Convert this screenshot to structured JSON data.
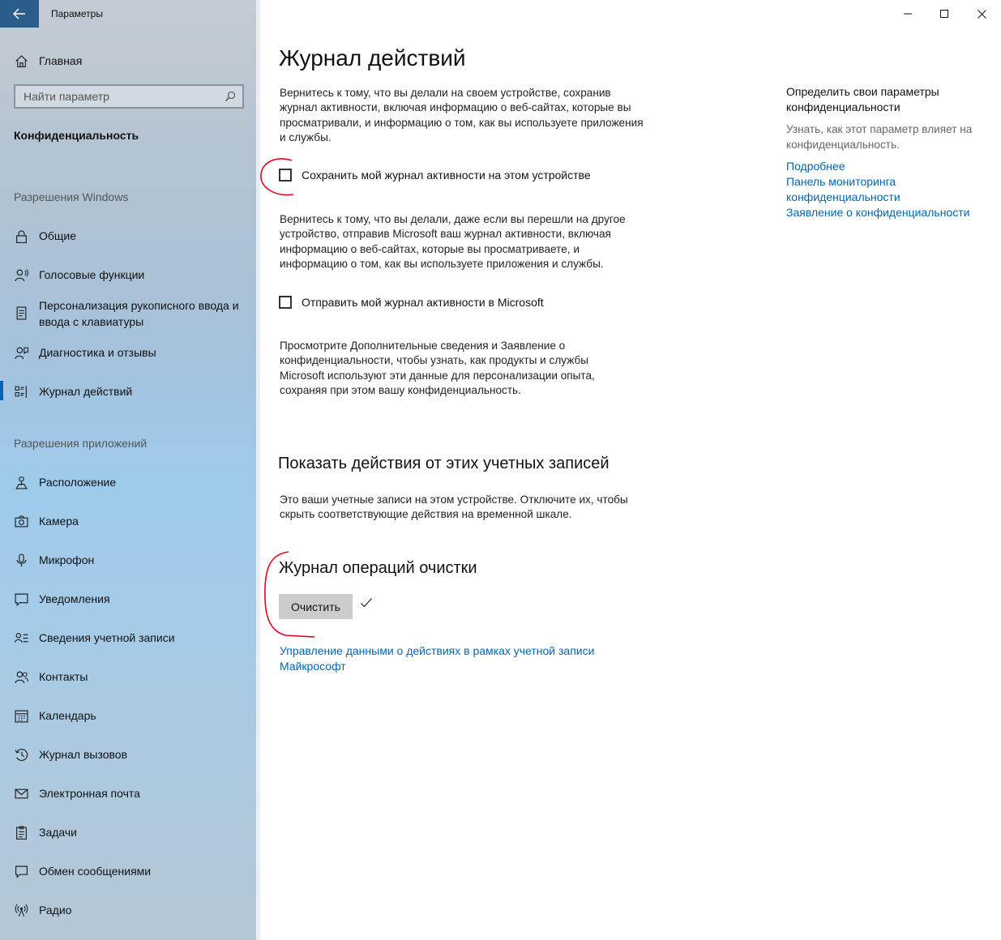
{
  "window": {
    "app_title": "Параметры",
    "back_icon": "back-arrow-icon",
    "controls": [
      "minimize-icon",
      "maximize-icon",
      "close-icon"
    ]
  },
  "sidebar": {
    "home_label": "Главная",
    "search_placeholder": "Найти параметр",
    "category": "Конфиденциальность",
    "windows_section": "Разрешения Windows",
    "windows_items": [
      {
        "label": "Общие",
        "icon": "lock-icon"
      },
      {
        "label": "Голосовые функции",
        "icon": "speech-icon"
      },
      {
        "label": "Персонализация рукописного ввода и ввода с клавиатуры",
        "icon": "handwriting-icon"
      },
      {
        "label": "Диагностика и отзывы",
        "icon": "feedback-icon"
      },
      {
        "label": "Журнал действий",
        "icon": "activity-history-icon",
        "active": true
      }
    ],
    "apps_section": "Разрешения приложений",
    "apps_items": [
      {
        "label": "Расположение",
        "icon": "location-icon"
      },
      {
        "label": "Камера",
        "icon": "camera-icon"
      },
      {
        "label": "Микрофон",
        "icon": "microphone-icon"
      },
      {
        "label": "Уведомления",
        "icon": "notifications-icon"
      },
      {
        "label": "Сведения учетной записи",
        "icon": "account-info-icon"
      },
      {
        "label": "Контакты",
        "icon": "contacts-icon"
      },
      {
        "label": "Календарь",
        "icon": "calendar-icon"
      },
      {
        "label": "Журнал вызовов",
        "icon": "call-history-icon"
      },
      {
        "label": "Электронная почта",
        "icon": "email-icon"
      },
      {
        "label": "Задачи",
        "icon": "tasks-icon"
      },
      {
        "label": "Обмен сообщениями",
        "icon": "messaging-icon"
      },
      {
        "label": "Радио",
        "icon": "radio-icon"
      }
    ]
  },
  "main": {
    "title": "Журнал действий",
    "intro": "Вернитесь к тому, что вы делали на своем устройстве, сохранив журнал активности, включая информацию о веб-сайтах, которые вы просматривали, и информацию о том, как вы используете приложения и службы.",
    "store_checkbox": {
      "label": "Сохранить мой журнал активности на этом устройстве",
      "checked": false
    },
    "send_intro": "Вернитесь к тому, что вы делали, даже если вы перешли на другое устройство, отправив Microsoft ваш журнал активности, включая информацию о веб-сайтах, которые вы просматриваете, и информацию о том, как вы используете приложения и службы.",
    "send_checkbox": {
      "label": "Отправить мой журнал активности в Microsoft",
      "checked": false
    },
    "privacy_note": "Просмотрите Дополнительные сведения и Заявление о конфиденциальности, чтобы узнать, как продукты и службы Microsoft используют эти данные для персонализации опыта, сохраняя при этом вашу конфиденциальность.",
    "accounts_heading": "Показать действия от этих учетных записей",
    "accounts_desc": "Это ваши учетные записи на этом устройстве. Отключите их, чтобы скрыть соответствующие действия на временной шкале.",
    "clear_heading": "Журнал операций очистки",
    "clear_button": "Очистить",
    "clear_done_icon": "checkmark-icon",
    "ms_link": "Управление данными о действиях в рамках учетной записи Майкрософт"
  },
  "right": {
    "heading": "Определить свои параметры конфиденциальности",
    "subtext": "Узнать, как этот параметр влияет на конфиденциальность.",
    "links": [
      "Подробнее",
      "Панель мониторинга конфиденциальности",
      "Заявление о конфиденциальности"
    ]
  },
  "colors": {
    "accent": "#0063b1",
    "link": "#0066b4",
    "annotation": "#e8001c",
    "back_button": "#2b5d8a"
  }
}
